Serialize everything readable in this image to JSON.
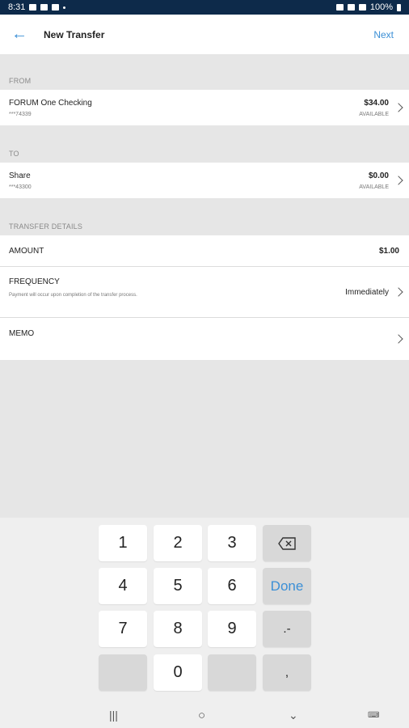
{
  "status_bar": {
    "time": "8:31",
    "battery": "100%"
  },
  "header": {
    "title": "New Transfer",
    "next_label": "Next"
  },
  "from": {
    "section_label": "FROM",
    "account_name": "FORUM One Checking",
    "account_number": "***74339",
    "balance": "$34.00",
    "balance_label": "AVAILABLE"
  },
  "to": {
    "section_label": "TO",
    "account_name": "Share",
    "account_number": "***43300",
    "balance": "$0.00",
    "balance_label": "AVAILABLE"
  },
  "details": {
    "section_label": "TRANSFER DETAILS",
    "amount_label": "AMOUNT",
    "amount_value": "$1.00",
    "frequency_label": "FREQUENCY",
    "frequency_note": "Payment will occur upon completion of the transfer process.",
    "frequency_value": "Immediately",
    "memo_label": "MEMO"
  },
  "keypad": {
    "keys": [
      "1",
      "2",
      "3",
      "4",
      "5",
      "6",
      "7",
      "8",
      "9",
      "0"
    ],
    "done_label": "Done",
    "dot_dash_label": ".-",
    "comma_label": ","
  },
  "icons": {
    "back": "arrow-left-icon",
    "chevron": "chevron-right-icon",
    "backspace": "backspace-icon"
  },
  "colors": {
    "accent": "#3b8fd6",
    "status_bar": "#0d2a4a",
    "background": "#e6e6e6"
  }
}
